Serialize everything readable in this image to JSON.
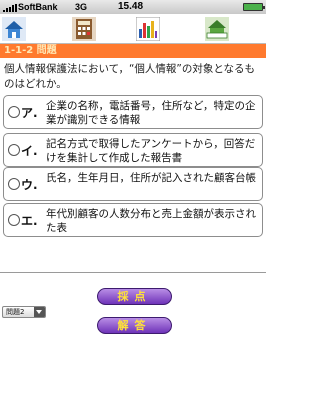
{
  "status_bar": {
    "carrier": "SoftBank",
    "network": "3G",
    "time": "15.48",
    "battery_color": "#4bb14b"
  },
  "toolbar": {
    "icons": [
      "home-icon",
      "calculator-icon",
      "chart-icon",
      "exit-icon"
    ]
  },
  "question_header": "1-1-2 問題",
  "question_text": "個人情報保護法において，“個人情報”の対象となるものはどれか。",
  "options": [
    {
      "letter": "ア.",
      "text": "企業の名称，電話番号，住所など，特定の企業が識別できる情報"
    },
    {
      "letter": "イ.",
      "text": "記名方式で取得したアンケートから，回答だけを集計して作成した報告書"
    },
    {
      "letter": "ウ.",
      "text": "氏名，生年月日，住所が記入された顧客台帳"
    },
    {
      "letter": "エ.",
      "text": "年代別顧客の人数分布と売上金額が表示された表"
    }
  ],
  "question_select": {
    "value": "問題2"
  },
  "buttons": {
    "grade_label": "採点",
    "answer_label": "解答"
  },
  "colors": {
    "header_bg": "#ff7a2e",
    "button_bg": "#6f33b8",
    "button_text": "#ffe23a"
  }
}
